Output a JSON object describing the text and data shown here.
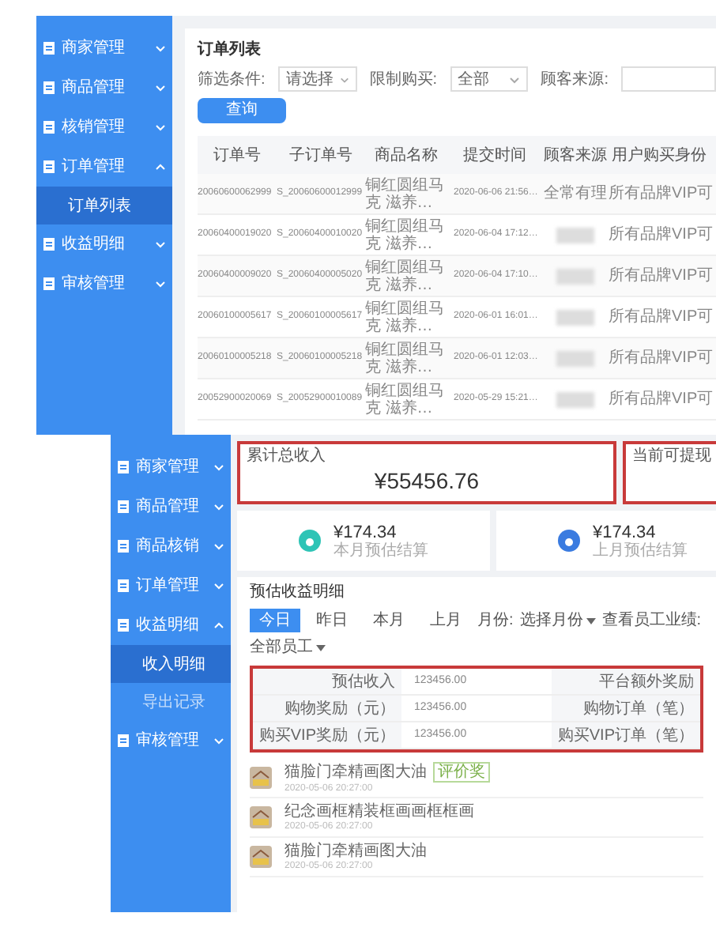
{
  "order_screen": {
    "sidebar": {
      "items": [
        {
          "label": "商家管理",
          "expanded": false
        },
        {
          "label": "商品管理",
          "expanded": false
        },
        {
          "label": "核销管理",
          "expanded": false
        },
        {
          "label": "订单管理",
          "expanded": true,
          "children": [
            {
              "label": "订单列表",
              "selected": true
            }
          ]
        },
        {
          "label": "收益明细",
          "expanded": false
        },
        {
          "label": "审核管理",
          "expanded": false
        }
      ]
    },
    "title": "订单列表",
    "filters": [
      {
        "kind": "select",
        "label": "筛选条件:",
        "value": "请选择"
      },
      {
        "kind": "select",
        "label": "限制购买:",
        "value": "全部"
      },
      {
        "kind": "input",
        "label": "顾客来源:"
      }
    ],
    "query_button": "查询",
    "table": {
      "columns": [
        "订单号",
        "子订单号",
        "商品名称",
        "提交时间",
        "顾客来源",
        "用户购买身份"
      ],
      "rows": [
        {
          "order_no": "20060600062999",
          "sub_order_no": "S_20060600012999",
          "product": "铜红圆组马克 滋养…",
          "submitted": "2020-06-06 21:56…",
          "source": "全常有理",
          "source_blurred": false,
          "identity": "所有品牌VIP可"
        },
        {
          "order_no": "20060400019020",
          "sub_order_no": "S_20060400010020",
          "product": "铜红圆组马克 滋养…",
          "submitted": "2020-06-04 17:12…",
          "source_blurred": true,
          "identity": "所有品牌VIP可"
        },
        {
          "order_no": "20060400009020",
          "sub_order_no": "S_20060400005020",
          "product": "铜红圆组马克 滋养…",
          "submitted": "2020-06-04 17:10…",
          "source_blurred": true,
          "identity": "所有品牌VIP可"
        },
        {
          "order_no": "20060100005617",
          "sub_order_no": "S_20060100005617",
          "product": "铜红圆组马克 滋养…",
          "submitted": "2020-06-01 16:01…",
          "source_blurred": true,
          "identity": "所有品牌VIP可"
        },
        {
          "order_no": "20060100005218",
          "sub_order_no": "S_20060100005218",
          "product": "铜红圆组马克 滋养…",
          "submitted": "2020-06-01 12:03…",
          "source_blurred": true,
          "identity": "所有品牌VIP可"
        },
        {
          "order_no": "20052900020069",
          "sub_order_no": "S_20052900010089",
          "product": "铜红圆组马克 滋养…",
          "submitted": "2020-05-29 15:21…",
          "source_blurred": true,
          "identity": "所有品牌VIP可"
        }
      ]
    }
  },
  "income_screen": {
    "sidebar": {
      "items": [
        {
          "label": "商家管理",
          "expanded": false
        },
        {
          "label": "商品管理",
          "expanded": false
        },
        {
          "label": "商品核销",
          "expanded": false
        },
        {
          "label": "订单管理",
          "expanded": false
        },
        {
          "label": "收益明细",
          "expanded": true,
          "children": [
            {
              "label": "收入明细",
              "selected": true
            },
            {
              "label": "导出记录",
              "selected": false
            }
          ]
        },
        {
          "label": "审核管理",
          "expanded": false
        }
      ]
    },
    "summary_cards": [
      {
        "label": "累计总收入",
        "value": "¥55456.76",
        "highlighted": true
      },
      {
        "label": "当前可提现",
        "highlighted": true
      }
    ],
    "stat_cards": [
      {
        "amount": "¥174.34",
        "caption": "本月预估结算",
        "color": "#2ec4b6"
      },
      {
        "amount": "¥174.34",
        "caption": "上月预估结算",
        "color": "#3a7be0"
      }
    ],
    "section_title": "预估收益明细",
    "period_tabs": [
      {
        "label": "今日",
        "selected": true
      },
      {
        "label": "昨日",
        "selected": false
      },
      {
        "label": "本月",
        "selected": false
      },
      {
        "label": "上月",
        "selected": false
      }
    ],
    "month_filter": {
      "label": "月份:",
      "value": "选择月份"
    },
    "staff_filter": {
      "label": "查看员工业绩:",
      "value": "全部员工"
    },
    "details": {
      "highlighted": true,
      "rows": [
        {
          "label": "预估收入",
          "value": "123456.00",
          "right_label": "平台额外奖励"
        },
        {
          "label": "购物奖励（元）",
          "value": "123456.00",
          "right_label": "购物订单（笔）"
        },
        {
          "label": "购买VIP奖励（元）",
          "value": "123456.00",
          "right_label": "购买VIP订单（笔）"
        }
      ]
    },
    "records": [
      {
        "title": "猫脸门牵精画图大油",
        "tag": "评价奖",
        "date": "2020-05-06 20:27:00"
      },
      {
        "title": "纪念画框精装框画画框框画",
        "date": "2020-05-06 20:27:00"
      },
      {
        "title": "猫脸门牵精画图大油",
        "date": "2020-05-06 20:27:00"
      }
    ]
  }
}
